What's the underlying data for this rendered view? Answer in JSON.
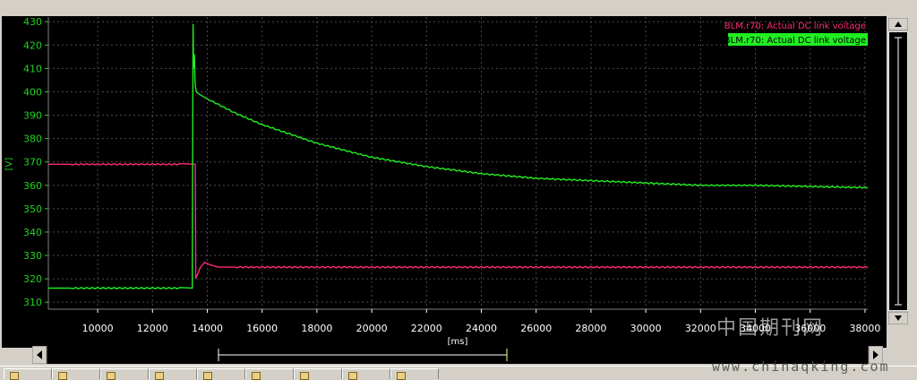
{
  "colors": {
    "plot_bg": "#000000",
    "grid": "#4a4a4a",
    "axis_text": "#20d020",
    "pink": "#ff2a7a",
    "green": "#20ee20",
    "frame": "#d4d0c8"
  },
  "icons": {
    "scroll_up": "triangle-up",
    "scroll_down": "triangle-down",
    "scroll_left": "triangle-left",
    "scroll_right": "triangle-right"
  },
  "watermark": {
    "cn": "中国期刊网",
    "url": "www.chinaqking.com"
  },
  "chart_data": {
    "type": "line",
    "title": "",
    "xlabel": "[ms]",
    "ylabel": "[V]",
    "xlim": [
      8200,
      38100
    ],
    "ylim": [
      307,
      432
    ],
    "xticks": [
      10000,
      12000,
      14000,
      16000,
      18000,
      20000,
      22000,
      24000,
      26000,
      28000,
      30000,
      32000,
      34000,
      36000,
      38000
    ],
    "yticks": [
      310,
      320,
      330,
      340,
      350,
      360,
      370,
      380,
      390,
      400,
      410,
      420,
      430
    ],
    "grid": true,
    "legend_position": "top-right",
    "series": [
      {
        "name": "BLM.r70: Actual DC link voltage",
        "color": "#ff2a7a",
        "x": [
          8200,
          9000,
          10000,
          11000,
          12000,
          13000,
          13560,
          13580,
          13600,
          13650,
          13750,
          13900,
          14100,
          14400,
          15000,
          16000,
          18000,
          20000,
          22000,
          24000,
          26000,
          28000,
          30000,
          32000,
          34000,
          36000,
          38100
        ],
        "y": [
          369,
          369,
          369,
          369,
          369,
          369,
          369,
          320,
          321,
          322,
          325,
          327,
          326,
          325,
          325,
          325,
          325,
          325,
          325,
          325,
          325,
          325,
          325,
          325,
          325,
          325,
          325
        ]
      },
      {
        "name": "BLM.r70: Actual DC link voltage",
        "color": "#20ee20",
        "x": [
          8200,
          9000,
          10000,
          11000,
          12000,
          13000,
          13450,
          13480,
          13500,
          13530,
          13550,
          13570,
          13600,
          13700,
          14000,
          15000,
          16000,
          17000,
          18000,
          19000,
          20000,
          22000,
          24000,
          26000,
          28000,
          30000,
          32000,
          34000,
          36000,
          38100
        ],
        "y": [
          316,
          316,
          316,
          316,
          316,
          316,
          316,
          429,
          410,
          416,
          405,
          402,
          400,
          399,
          397,
          391,
          386,
          382,
          378,
          375,
          372,
          368,
          365,
          363,
          362,
          361,
          360,
          360,
          359.5,
          359
        ]
      }
    ]
  }
}
